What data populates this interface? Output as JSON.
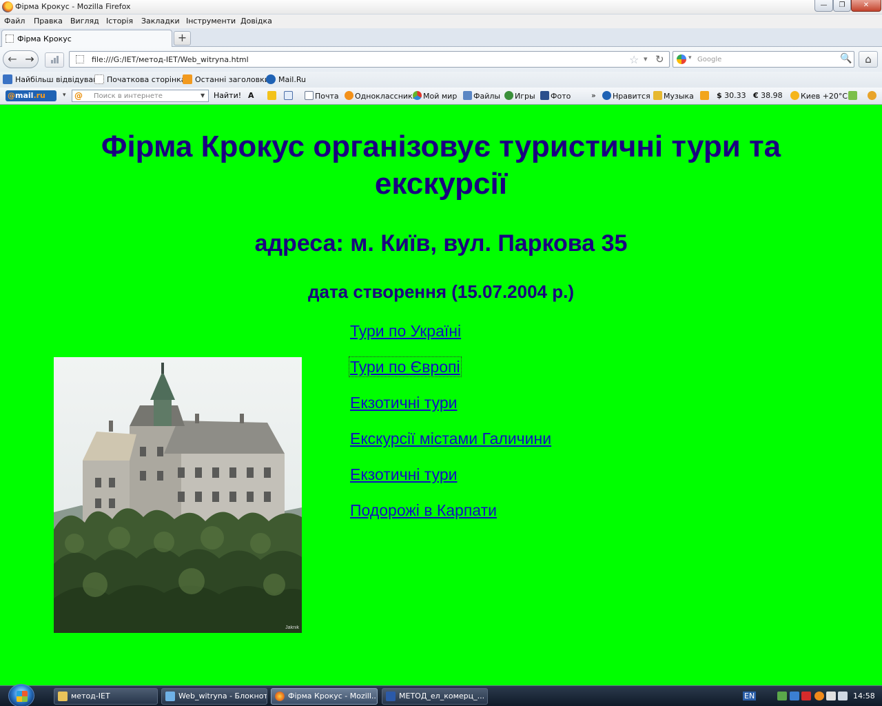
{
  "window": {
    "title": "Фірма Крокус - Mozilla Firefox",
    "minimize_glyph": "—",
    "maximize_glyph": "❐",
    "close_glyph": "✕"
  },
  "menu": [
    "Файл",
    "Правка",
    "Вигляд",
    "Історія",
    "Закладки",
    "Інструменти",
    "Довідка"
  ],
  "tab": {
    "label": "Фірма Крокус",
    "new_tab_glyph": "+"
  },
  "nav": {
    "url": "file:///G:/IET/метод-IET/Web_witryna.html",
    "search_placeholder": "Google",
    "back_glyph": "←",
    "forward_glyph": "→",
    "star_glyph": "☆",
    "dropdown_glyph": "▾",
    "reload_glyph": "↻",
    "search_glyph": "🔍",
    "home_glyph": "⌂"
  },
  "bookmarks": [
    "Найбільш відвідувані",
    "Початкова сторінка",
    "Останні заголовки",
    "Mail.Ru"
  ],
  "mailru_toolbar": {
    "logo_at": "@",
    "logo_name": "mail",
    "logo_tld": ".ru",
    "dropdown_glyph": "▾",
    "search_at": "@",
    "search_placeholder": "Поиск в интернете",
    "search_arrow": "▼",
    "find_label": "Найти!",
    "font_size_label": "A",
    "items": [
      "Почта",
      "Одноклассники",
      "Мой мир",
      "Файлы",
      "Игры",
      "Фото"
    ],
    "more_glyph": "»",
    "like_label": "Нравится",
    "music_label": "Музыка",
    "usd_symbol": "$",
    "usd_rate": "30.33",
    "eur_symbol": "€",
    "eur_rate": "38.98",
    "weather": "Киев +20°C"
  },
  "page": {
    "background_color": "#00ff00",
    "text_color": "#1a0080",
    "link_color": "#1010c0",
    "heading1": "Фірма Крокус організовує туристичні тури та екскурсії",
    "heading2": "адреса: м. Київ, вул. Паркова 35",
    "heading3": "дата створення (15.07.2004 р.)",
    "photo_watermark": "Jaknik",
    "links": [
      "Тури по Україні",
      "Тури по Європі",
      "Екзотичні тури",
      "Екскурсії містами Галичини",
      "Екзотичні тури",
      "Подорожі в Карпати"
    ]
  },
  "taskbar": {
    "tasks": [
      "метод-IET",
      "Web_witryna - Блокнот",
      "Фірма Крокус - Mozill...",
      "МЕТОД_ел_комерц_..."
    ],
    "language": "EN",
    "clock": "14:58"
  }
}
